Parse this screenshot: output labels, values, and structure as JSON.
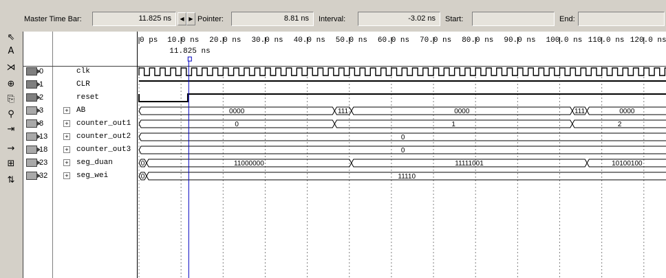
{
  "toolbar": {
    "master_time_bar_label": "Master Time Bar:",
    "master_time_bar_value": "11.825 ns",
    "pointer_label": "Pointer:",
    "pointer_value": "8.81 ns",
    "interval_label": "Interval:",
    "interval_value": "-3.02 ns",
    "start_label": "Start:",
    "start_value": "",
    "end_label": "End:",
    "end_value": ""
  },
  "left_tools": [
    {
      "name": "pointer-tool-icon",
      "glyph": "⇖"
    },
    {
      "name": "text-tool-icon",
      "glyph": "A"
    },
    {
      "name": "waveform-editing-tool-icon",
      "glyph": "⋊"
    },
    {
      "name": "zoom-tool-icon",
      "glyph": "⊕"
    },
    {
      "name": "copy-icon",
      "glyph": "⎘"
    },
    {
      "name": "find-icon",
      "glyph": "⚲"
    },
    {
      "name": "replace-icon",
      "glyph": "⇥"
    },
    {
      "name": "next-transition-icon",
      "glyph": "→"
    },
    {
      "name": "snap-to-grid-icon",
      "glyph": "⊞"
    },
    {
      "name": "sort-icon",
      "glyph": "⇅"
    }
  ],
  "timeline": {
    "time_min": 0,
    "time_max": 125.5,
    "ticks": [
      {
        "t": 0,
        "label": "0 ps"
      },
      {
        "t": 10,
        "label": "10.0 ns"
      },
      {
        "t": 20,
        "label": "20.0 ns"
      },
      {
        "t": 30,
        "label": "30.0 ns"
      },
      {
        "t": 40,
        "label": "40.0 ns"
      },
      {
        "t": 50,
        "label": "50.0 ns"
      },
      {
        "t": 60,
        "label": "60.0 ns"
      },
      {
        "t": 70,
        "label": "70.0 ns"
      },
      {
        "t": 80,
        "label": "80.0 ns"
      },
      {
        "t": 90,
        "label": "90.0 ns"
      },
      {
        "t": 100,
        "label": "100.0 ns"
      },
      {
        "t": 110,
        "label": "110.0 ns"
      },
      {
        "t": 120,
        "label": "120.0 ns"
      }
    ],
    "cursor_time": 11.825,
    "cursor_label": "11.825 ns"
  },
  "signals": [
    {
      "index": "0",
      "name": "clk",
      "kind": "clock",
      "bus": false,
      "half_period": 1.25
    },
    {
      "index": "1",
      "name": "CLR",
      "kind": "high",
      "bus": false
    },
    {
      "index": "2",
      "name": "reset",
      "kind": "step",
      "bus": false,
      "low_until": 11.6
    },
    {
      "index": "3",
      "name": "AB",
      "kind": "bus",
      "bus": true,
      "segments": [
        {
          "start": 0,
          "end": 46.5,
          "value": "0000"
        },
        {
          "start": 46.5,
          "end": 50.5,
          "value": "111"
        },
        {
          "start": 50.5,
          "end": 103,
          "value": "0000"
        },
        {
          "start": 103,
          "end": 106.5,
          "value": "111"
        },
        {
          "start": 106.5,
          "end": 125.5,
          "value": "0000"
        }
      ]
    },
    {
      "index": "8",
      "name": "counter_out1",
      "kind": "bus",
      "bus": true,
      "segments": [
        {
          "start": 0,
          "end": 46.5,
          "value": "0"
        },
        {
          "start": 46.5,
          "end": 103,
          "value": "1"
        },
        {
          "start": 103,
          "end": 125.5,
          "value": "2"
        }
      ]
    },
    {
      "index": "13",
      "name": "counter_out2",
      "kind": "bus",
      "bus": true,
      "segments": [
        {
          "start": 0,
          "end": 125.5,
          "value": "0"
        }
      ]
    },
    {
      "index": "18",
      "name": "counter_out3",
      "kind": "bus",
      "bus": true,
      "segments": [
        {
          "start": 0,
          "end": 125.5,
          "value": "0"
        }
      ]
    },
    {
      "index": "23",
      "name": "seg_duan",
      "kind": "bus",
      "bus": true,
      "segments": [
        {
          "start": 0,
          "end": 1.8,
          "value": "0"
        },
        {
          "start": 1.8,
          "end": 50.5,
          "value": "11000000"
        },
        {
          "start": 50.5,
          "end": 106.5,
          "value": "11111001"
        },
        {
          "start": 106.5,
          "end": 125.5,
          "value": "10100100"
        }
      ]
    },
    {
      "index": "32",
      "name": "seg_wei",
      "kind": "bus",
      "bus": true,
      "segments": [
        {
          "start": 0,
          "end": 1.8,
          "value": "0"
        },
        {
          "start": 1.8,
          "end": 125.5,
          "value": "11110"
        }
      ]
    }
  ],
  "colors": {
    "background": "#d4d0c8",
    "waveform": "#000000",
    "cursor": "#0000c0",
    "grid": "#808080"
  }
}
